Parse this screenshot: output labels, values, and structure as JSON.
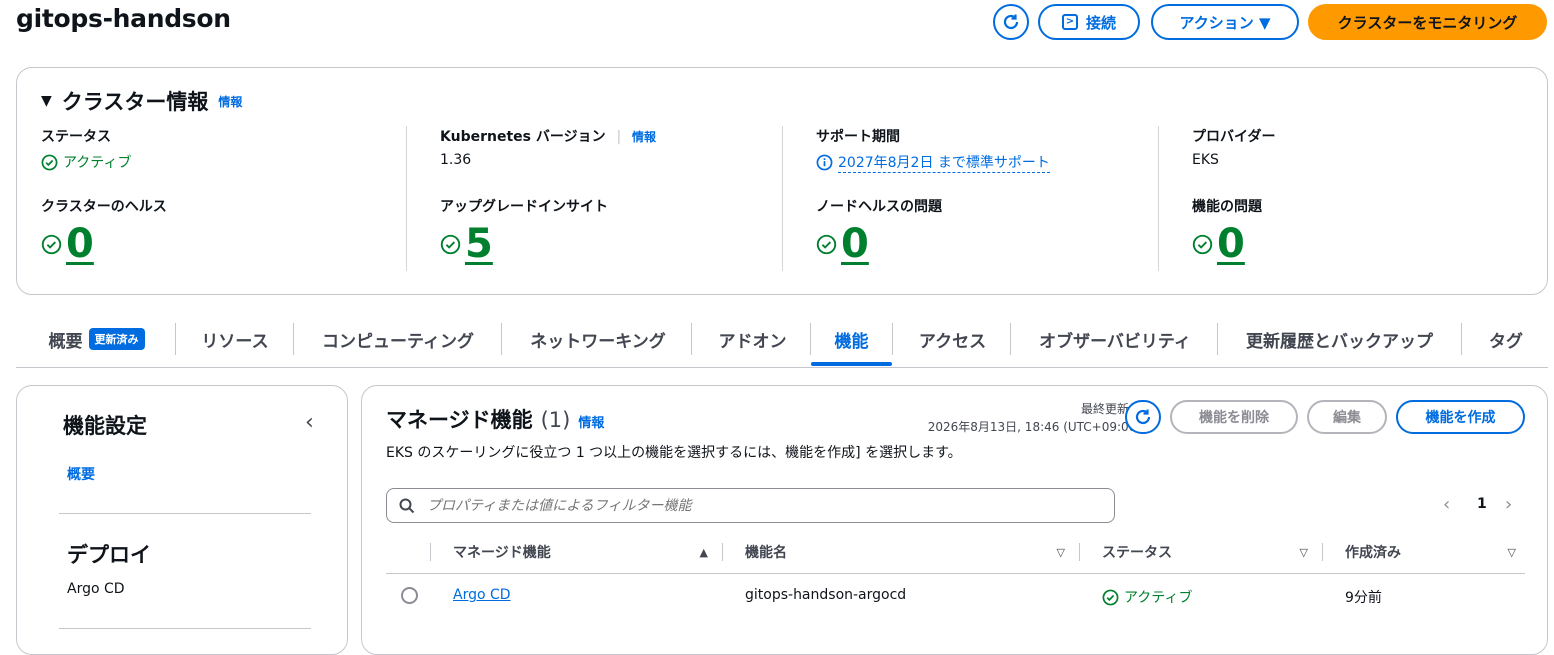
{
  "header": {
    "title": "gitops-handson",
    "connect_label": "接続",
    "actions_label": "アクション ▼",
    "monitor_label": "クラスターをモニタリング"
  },
  "cluster_info": {
    "title": "クラスター情報",
    "info_link": "情報",
    "status": {
      "label": "ステータス",
      "value": "アクティブ"
    },
    "k8s_version": {
      "label": "Kubernetes バージョン",
      "info": "情報",
      "value": "1.36"
    },
    "support": {
      "label": "サポート期間",
      "value": "2027年8月2日 まで標準サポート"
    },
    "provider": {
      "label": "プロバイダー",
      "value": "EKS"
    },
    "cluster_health": {
      "label": "クラスターのヘルス",
      "value": "0"
    },
    "upgrade_insights": {
      "label": "アップグレードインサイト",
      "value": "5"
    },
    "node_health": {
      "label": "ノードヘルスの問題",
      "value": "0"
    },
    "capability_issues": {
      "label": "機能の問題",
      "value": "0"
    }
  },
  "tabs": [
    {
      "label": "概要",
      "badge": "更新済み"
    },
    {
      "label": "リソース"
    },
    {
      "label": "コンピューティング"
    },
    {
      "label": "ネットワーキング"
    },
    {
      "label": "アドオン"
    },
    {
      "label": "機能",
      "active": true
    },
    {
      "label": "アクセス"
    },
    {
      "label": "オブザーバビリティ"
    },
    {
      "label": "更新履歴とバックアップ"
    },
    {
      "label": "タグ"
    }
  ],
  "left_panel": {
    "title": "機能設定",
    "overview_link": "概要",
    "deploy_heading": "デプロイ",
    "deploy_item": "Argo CD"
  },
  "managed": {
    "title": "マネージド機能",
    "count": "(1)",
    "info": "情報",
    "description": "EKS のスケーリングに役立つ 1 つ以上の機能を選択するには、機能を作成] を選択します。",
    "last_updated_label": "最終更新日",
    "last_updated_value": "2026年8月13日, 18:46 (UTC+09:00)",
    "delete_label": "機能を削除",
    "edit_label": "編集",
    "create_label": "機能を作成",
    "filter_placeholder": "プロパティまたは値によるフィルター機能",
    "page": "1",
    "columns": [
      "マネージド機能",
      "機能名",
      "ステータス",
      "作成済み"
    ],
    "rows": [
      {
        "managed": "Argo CD",
        "name": "gitops-handson-argocd",
        "status": "アクティブ",
        "created": "9分前"
      }
    ]
  },
  "colors": {
    "accent": "#006ce0",
    "primary": "#ff9900",
    "success": "#00802f"
  }
}
